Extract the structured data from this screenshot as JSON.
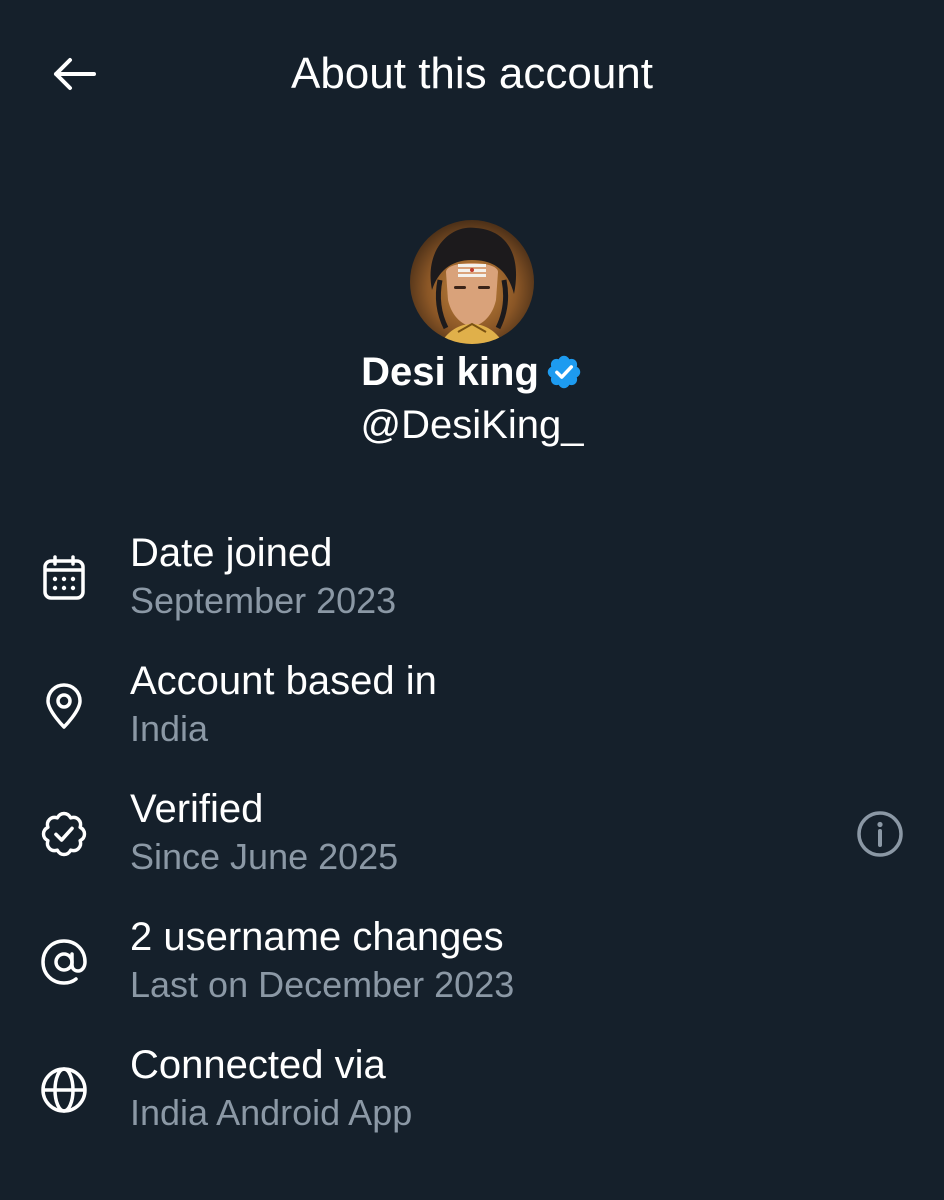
{
  "header": {
    "title": "About this account",
    "back_icon": "arrow-left-icon"
  },
  "profile": {
    "display_name": "Desi king",
    "handle": "@DesiKing_",
    "verified_icon": "verified-badge-icon",
    "badge_color": "#1d9bf0"
  },
  "info": [
    {
      "icon": "calendar-icon",
      "label": "Date joined",
      "value": "September 2023"
    },
    {
      "icon": "location-pin-icon",
      "label": "Account based in",
      "value": "India"
    },
    {
      "icon": "verified-check-icon",
      "label": "Verified",
      "value": "Since June 2025",
      "action_icon": "info-icon"
    },
    {
      "icon": "at-sign-icon",
      "label": "2 username changes",
      "value": "Last on December 2023"
    },
    {
      "icon": "globe-icon",
      "label": "Connected via",
      "value": "India Android App"
    }
  ],
  "colors": {
    "background": "#15202b",
    "primary_text": "#ffffff",
    "secondary_text": "#8b98a5",
    "accent": "#1d9bf0"
  }
}
